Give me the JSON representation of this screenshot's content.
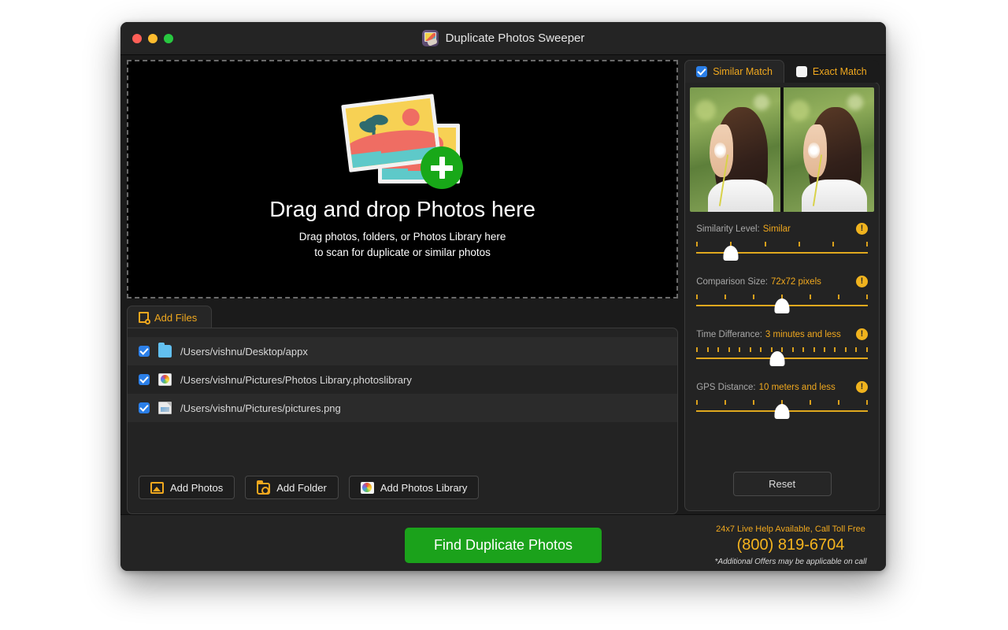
{
  "window": {
    "title": "Duplicate Photos Sweeper",
    "app_icon": "photos-sweeper-icon",
    "traffic_lights": [
      "close-button",
      "minimize-button",
      "zoom-button"
    ]
  },
  "dropzone": {
    "icon": "add-photos-illustration",
    "title": "Drag and drop Photos here",
    "subtitle_line1": "Drag photos, folders, or Photos Library here",
    "subtitle_line2": "to scan for duplicate or similar photos"
  },
  "add_files_panel": {
    "tab_label": "Add Files",
    "tab_icon": "file-add-icon",
    "files": [
      {
        "checked": true,
        "icon": "folder-icon",
        "path": "/Users/vishnu/Desktop/appx"
      },
      {
        "checked": true,
        "icon": "photos-library-icon",
        "path": "/Users/vishnu/Pictures/Photos Library.photoslibrary"
      },
      {
        "checked": true,
        "icon": "png-file-icon",
        "path": "/Users/vishnu/Pictures/pictures.png"
      }
    ],
    "buttons": [
      {
        "label": "Add Photos",
        "icon": "image-add-icon"
      },
      {
        "label": "Add Folder",
        "icon": "folder-add-icon"
      },
      {
        "label": "Add Photos Library",
        "icon": "photos-library-icon"
      }
    ]
  },
  "match_panel": {
    "tabs": [
      {
        "label": "Similar Match",
        "checked": true,
        "active": true
      },
      {
        "label": "Exact Match",
        "checked": false,
        "active": false
      }
    ],
    "preview": {
      "left_image": "girl-blowing-dandelion-photo",
      "right_image": "girl-blowing-dandelion-photo-duplicate"
    },
    "sliders": [
      {
        "label": "Similarity Level:",
        "value": "Similar",
        "warn_icon": "info-warning-icon",
        "ticks": 6,
        "thumb_percent": 20
      },
      {
        "label": "Comparison Size:",
        "value": "72x72 pixels",
        "warn_icon": "info-warning-icon",
        "ticks": 7,
        "thumb_percent": 50
      },
      {
        "label": "Time Differance:",
        "value": "3 minutes and less",
        "warn_icon": "info-warning-icon",
        "ticks": 17,
        "thumb_percent": 47
      },
      {
        "label": "GPS Distance:",
        "value": "10 meters and less",
        "warn_icon": "info-warning-icon",
        "ticks": 7,
        "thumb_percent": 50
      }
    ],
    "reset_label": "Reset"
  },
  "footer": {
    "cta_label": "Find Duplicate Photos",
    "help_line": "24x7 Live Help Available, Call Toll Free",
    "phone": "(800) 819-6704",
    "note": "*Additional Offers may be applicable on call"
  },
  "colors": {
    "accent_amber": "#f0a81e",
    "cta_green": "#1ba21b",
    "checkbox_blue": "#2b7fe8",
    "panel_bg": "#232323",
    "window_bg": "#1b1b1b"
  }
}
